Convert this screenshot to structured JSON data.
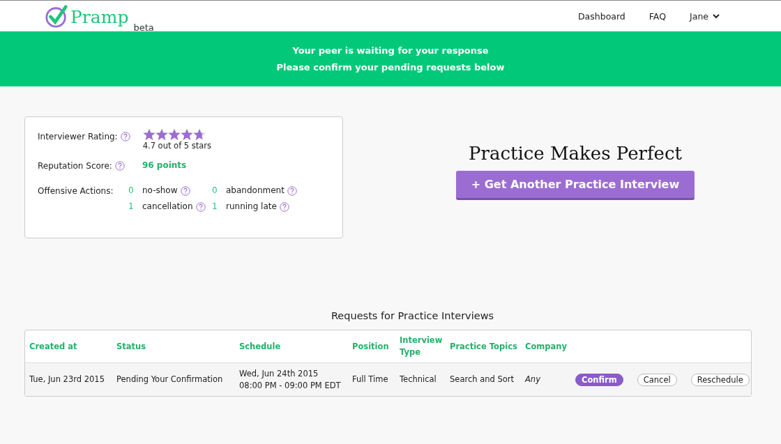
{
  "header": {
    "logo": "Pramp",
    "badge": "beta",
    "nav": [
      {
        "label": "Dashboard",
        "kind": "link"
      },
      {
        "label": "FAQ",
        "kind": "link"
      },
      {
        "label": "Jane",
        "kind": "menu"
      }
    ]
  },
  "banner": {
    "lines": [
      "Your peer is waiting for your response",
      "Please **confirm** your pending requests below"
    ]
  },
  "stats": {
    "rating_label": "Interviewer Rating:",
    "stars": 4.7,
    "rating_text": "4.7 out of 5 stars",
    "reputation_label": "Reputation Score:",
    "reputation": "96 points",
    "offensive_label": "Offensive Actions:",
    "actions": [
      {
        "count": "0",
        "label": "no-show"
      },
      {
        "count": "0",
        "label": "abandonment"
      },
      {
        "count": "1",
        "label": "cancellation"
      },
      {
        "count": "1",
        "label": "running late"
      }
    ]
  },
  "cta": {
    "title": "Practice Makes Perfect",
    "button": "+ Get Another Practice Interview"
  },
  "requests": {
    "title": "Requests for Practice Interviews",
    "columns": [
      "Created at",
      "Status",
      "Schedule",
      "Position",
      "Interview Type",
      "Practice Topics",
      "Company"
    ],
    "rows": [
      {
        "created": "Tue, Jun 23rd 2015",
        "status": "Pending Your Confirmation",
        "schedule_date": "Wed, Jun 24th 2015",
        "schedule_time": "08:00 PM - 09:00 PM EDT",
        "position": "Full Time",
        "type": "Technical",
        "topics": "Search and Sort",
        "company": "Any",
        "actions": [
          {
            "label": "Confirm",
            "kind": "primary"
          },
          {
            "label": "Cancel",
            "kind": "outline"
          },
          {
            "label": "Reschedule",
            "kind": "outline"
          }
        ]
      }
    ]
  }
}
